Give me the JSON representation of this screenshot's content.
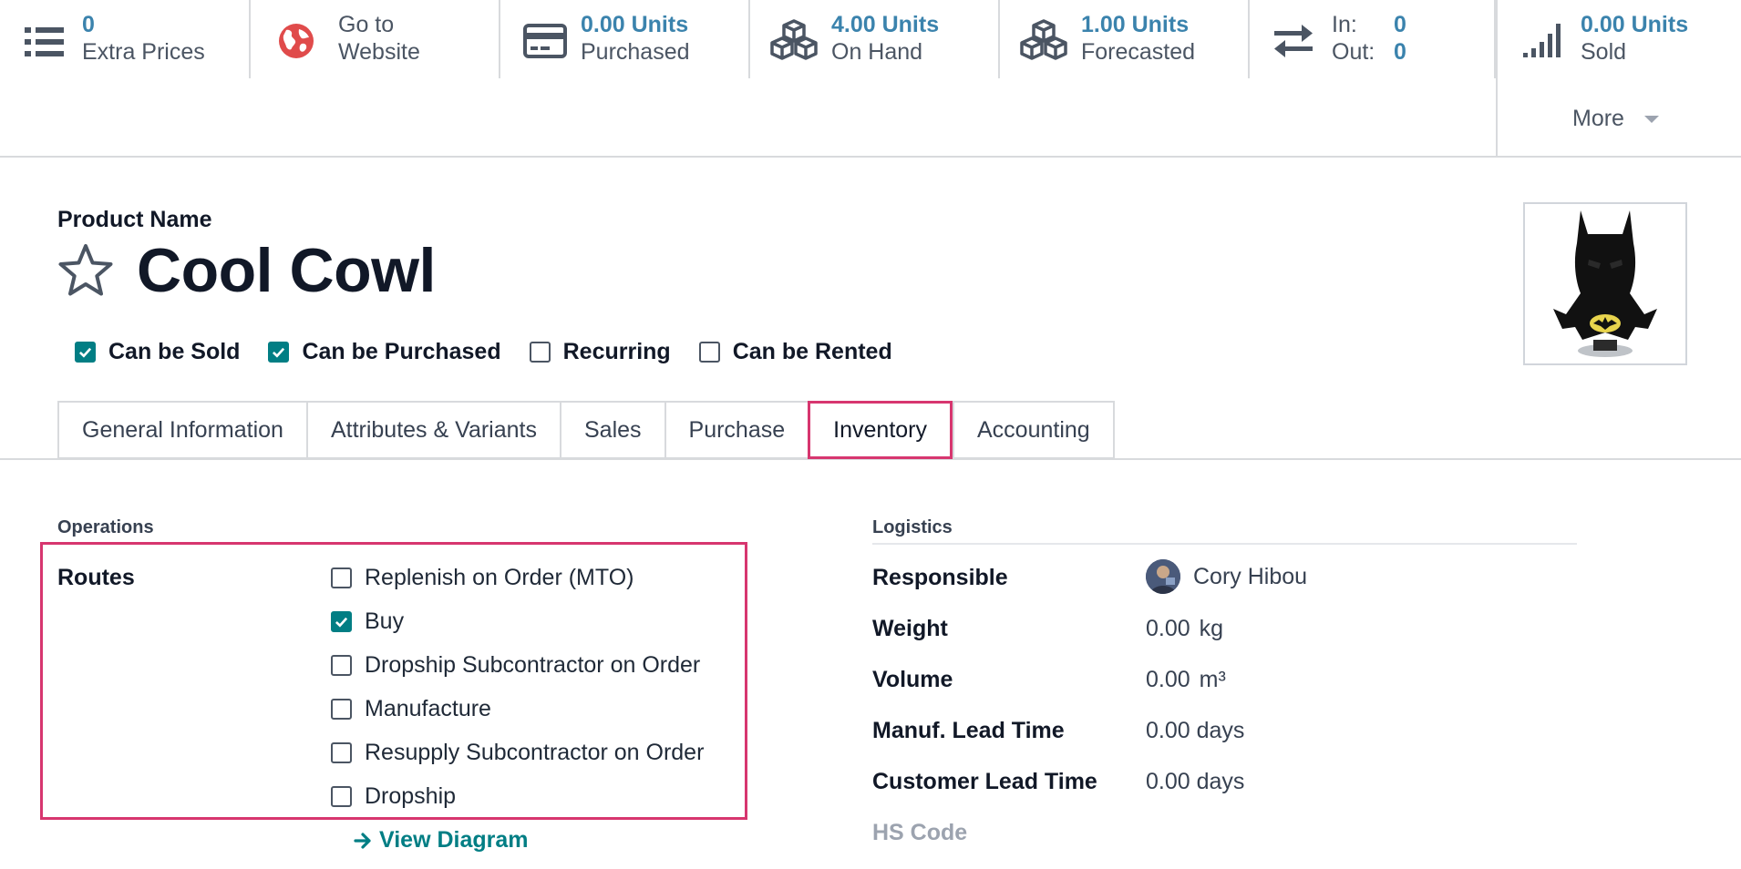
{
  "smart_buttons": {
    "extra_prices": {
      "value": "0",
      "label": "Extra Prices",
      "icon": "list-icon"
    },
    "website": {
      "line1": "Go to",
      "line2": "Website",
      "icon": "globe-icon",
      "color": "#e04b4b"
    },
    "purchased": {
      "value": "0.00 Units",
      "label": "Purchased",
      "icon": "credit-card-icon"
    },
    "on_hand": {
      "value": "4.00 Units",
      "label": "On Hand",
      "icon": "cubes-icon"
    },
    "forecasted": {
      "value": "1.00 Units",
      "label": "Forecasted",
      "icon": "cubes-icon"
    },
    "in_out": {
      "in_label": "In:",
      "in_value": "0",
      "out_label": "Out:",
      "out_value": "0",
      "icon": "exchange-icon"
    },
    "sold": {
      "value": "0.00 Units",
      "label": "Sold",
      "icon": "signal-icon"
    },
    "more_label": "More"
  },
  "product": {
    "name_label": "Product Name",
    "name": "Cool Cowl",
    "favorite": false,
    "image_alt": "batman-cowl-image"
  },
  "flags": [
    {
      "label": "Can be Sold",
      "checked": true
    },
    {
      "label": "Can be Purchased",
      "checked": true
    },
    {
      "label": "Recurring",
      "checked": false
    },
    {
      "label": "Can be Rented",
      "checked": false
    }
  ],
  "tabs": [
    {
      "label": "General Information",
      "active": false
    },
    {
      "label": "Attributes & Variants",
      "active": false
    },
    {
      "label": "Sales",
      "active": false
    },
    {
      "label": "Purchase",
      "active": false
    },
    {
      "label": "Inventory",
      "active": true
    },
    {
      "label": "Accounting",
      "active": false
    }
  ],
  "operations": {
    "title": "Operations",
    "routes_label": "Routes",
    "routes": [
      {
        "label": "Replenish on Order (MTO)",
        "checked": false
      },
      {
        "label": "Buy",
        "checked": true
      },
      {
        "label": "Dropship Subcontractor on Order",
        "checked": false
      },
      {
        "label": "Manufacture",
        "checked": false
      },
      {
        "label": "Resupply Subcontractor on Order",
        "checked": false
      },
      {
        "label": "Dropship",
        "checked": false
      }
    ],
    "view_diagram": "View Diagram"
  },
  "logistics": {
    "title": "Logistics",
    "responsible_label": "Responsible",
    "responsible_value": "Cory Hibou",
    "weight_label": "Weight",
    "weight_value": "0.00",
    "weight_unit": "kg",
    "volume_label": "Volume",
    "volume_value": "0.00",
    "volume_unit": "m³",
    "manuf_lead_label": "Manuf. Lead Time",
    "manuf_lead_value": "0.00 days",
    "customer_lead_label": "Customer Lead Time",
    "customer_lead_value": "0.00 days",
    "hs_code_label": "HS Code"
  },
  "colors": {
    "accent": "#017e84",
    "link_value": "#3b83ad",
    "highlight": "#d7366f"
  }
}
